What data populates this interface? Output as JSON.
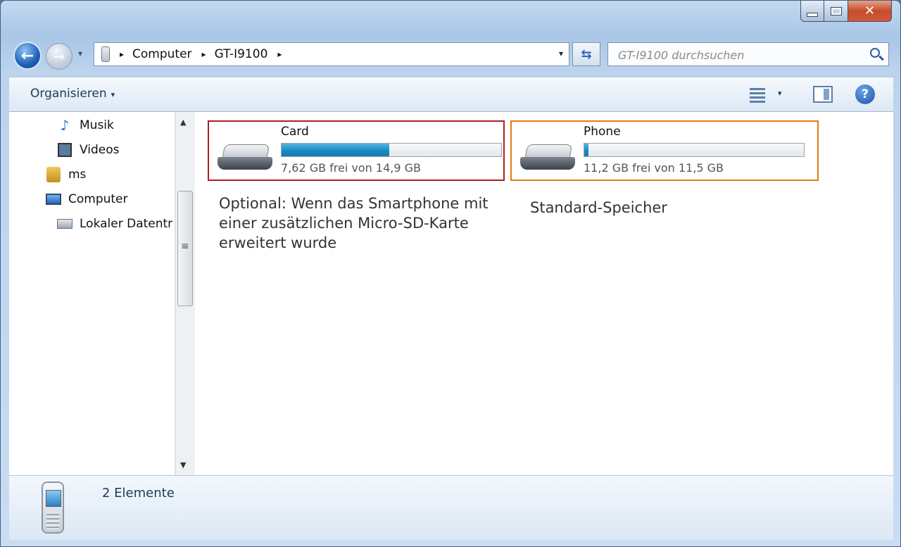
{
  "window": {
    "close_glyph": "✕"
  },
  "nav": {
    "back_glyph": "←",
    "forward_glyph": "→",
    "history_glyph": "▾",
    "breadcrumb": [
      "Computer",
      "GT-I9100"
    ],
    "separator_glyph": "▸",
    "address_dropdown_glyph": "▾",
    "refresh_glyph": "⇆",
    "search_placeholder": "GT-I9100 durchsuchen"
  },
  "toolbar": {
    "organize_label": "Organisieren",
    "caret_glyph": "▾",
    "help_glyph": "?"
  },
  "sidebar": {
    "items": [
      {
        "label": "Musik",
        "icon": "music-icon"
      },
      {
        "label": "Videos",
        "icon": "video-icon"
      },
      {
        "label": "ms",
        "icon": "user-folder-icon"
      },
      {
        "label": "Computer",
        "icon": "computer-icon"
      },
      {
        "label": "Lokaler Datentr",
        "icon": "local-disk-icon"
      }
    ]
  },
  "scrollbar": {
    "up_glyph": "▲",
    "down_glyph": "▼"
  },
  "drives": [
    {
      "name": "Card",
      "free_text": "7,62 GB frei von 14,9 GB",
      "used_fraction": 0.49,
      "highlight_color": "#b01e1e"
    },
    {
      "name": "Phone",
      "free_text": "11,2 GB frei von 11,5 GB",
      "used_fraction": 0.02,
      "highlight_color": "#e57b0e"
    }
  ],
  "annotations": {
    "card": "Optional: Wenn das Smartphone mit einer zusätzlichen Micro-SD-Karte erweitert wurde",
    "phone": "Standard-Speicher"
  },
  "details": {
    "item_count": "2 Elemente"
  }
}
